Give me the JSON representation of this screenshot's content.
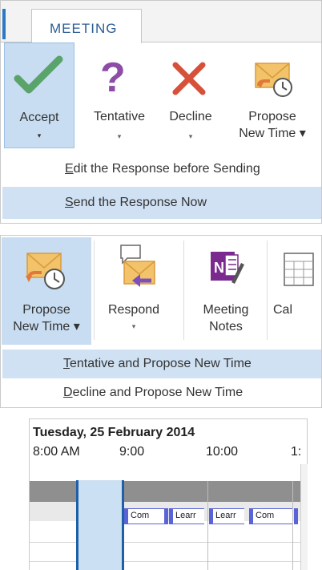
{
  "panel1": {
    "tab_label": "MEETING",
    "buttons": {
      "accept": "Accept",
      "tentative": "Tentative",
      "tentative_icon_char": "?",
      "decline": "Decline",
      "propose_line1": "Propose",
      "propose_line2": "New Time ▾"
    },
    "arrow": "▾",
    "menu": {
      "edit_key": "E",
      "edit_rest": "dit the Response before Sending",
      "send_key": "S",
      "send_rest": "end the Response Now"
    }
  },
  "panel2": {
    "buttons": {
      "propose_line1": "Propose",
      "propose_line2": "New Time ▾",
      "respond": "Respond",
      "notes_line1": "Meeting",
      "notes_line2": "Notes",
      "calendar_partial": "Cal"
    },
    "arrow": "▾",
    "menu": {
      "tentative_key": "T",
      "tentative_rest": "entative and Propose New Time",
      "decline_key": "D",
      "decline_rest": "ecline and Propose New Time"
    }
  },
  "panel3": {
    "date": "Tuesday, 25 February 2014",
    "times": [
      "8:00 AM",
      "9:00",
      "10:00",
      "1:"
    ],
    "appointments": [
      "Com",
      "Learr",
      "Learr",
      "Com"
    ]
  },
  "colors": {
    "selected_bg": "#c8ddf1",
    "menu_highlight": "#cfe1f3",
    "accent_blue": "#2b79c2",
    "appointment_bar": "#5964d6"
  }
}
